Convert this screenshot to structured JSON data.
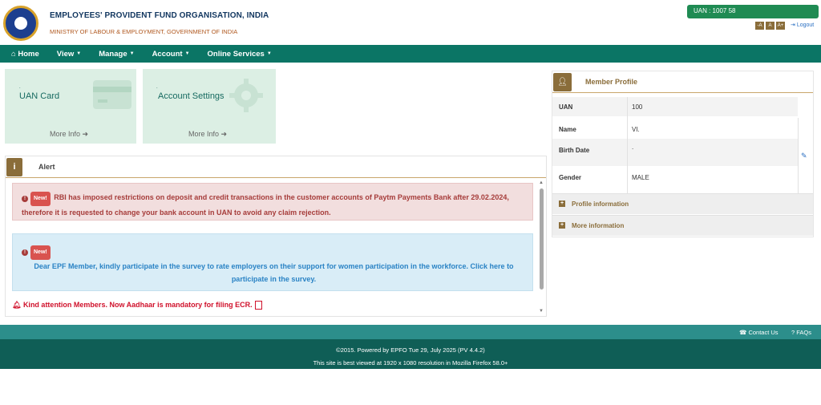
{
  "header": {
    "org_name": "EMPLOYEES' PROVIDENT FUND ORGANISATION, INDIA",
    "ministry": "MINISTRY OF LABOUR & EMPLOYMENT, GOVERNMENT OF INDIA",
    "uan_label": "UAN : 1007 58",
    "font_buttons": [
      "-A",
      "A",
      "A+"
    ],
    "logout": "Logout"
  },
  "nav": {
    "items": [
      {
        "label": "Home",
        "icon": "home-icon"
      },
      {
        "label": "View",
        "caret": true
      },
      {
        "label": "Manage",
        "caret": true
      },
      {
        "label": "Account",
        "caret": true
      },
      {
        "label": "Online Services",
        "caret": true
      }
    ]
  },
  "tiles": [
    {
      "title": "UAN Card",
      "more": "More Info",
      "icon": "card-icon"
    },
    {
      "title": "Account Settings",
      "more": "More Info",
      "icon": "gear-icon"
    }
  ],
  "alert": {
    "title": "Alert",
    "badge": "New!",
    "msg1": "RBI has imposed restrictions on deposit and credit transactions in the customer accounts of Paytm Payments Bank after 29.02.2024, therefore it is requested to change your bank account in UAN to avoid any claim rejection.",
    "msg2": "Dear EPF Member, kindly participate in the survey to rate employers on their support for women participation in the workforce. Click here to participate in the survey.",
    "notice": "Kind attention Members. Now Aadhaar is mandatory for filing ECR."
  },
  "profile": {
    "title": "Member Profile",
    "rows": [
      {
        "k": "UAN",
        "v": "100"
      },
      {
        "k": "Name",
        "v": "VI."
      },
      {
        "k": "Birth Date",
        "v": "."
      },
      {
        "k": "Gender",
        "v": "MALE"
      }
    ],
    "accordions": [
      "Profile information",
      "More information"
    ]
  },
  "footer": {
    "contact": "Contact Us",
    "faqs": "FAQs",
    "line1": "©2015. Powered by EPFO Tue 29, July 2025 (PV 4.4.2)",
    "line2": "This site is best viewed at 1920 x 1080 resolution in Mozilla Firefox 58.0+"
  },
  "colors": {
    "nav": "#0b7565",
    "accent_brown": "#8a6d3a",
    "uan_green": "#1f8b53",
    "footer_dark": "#0f5e56"
  }
}
